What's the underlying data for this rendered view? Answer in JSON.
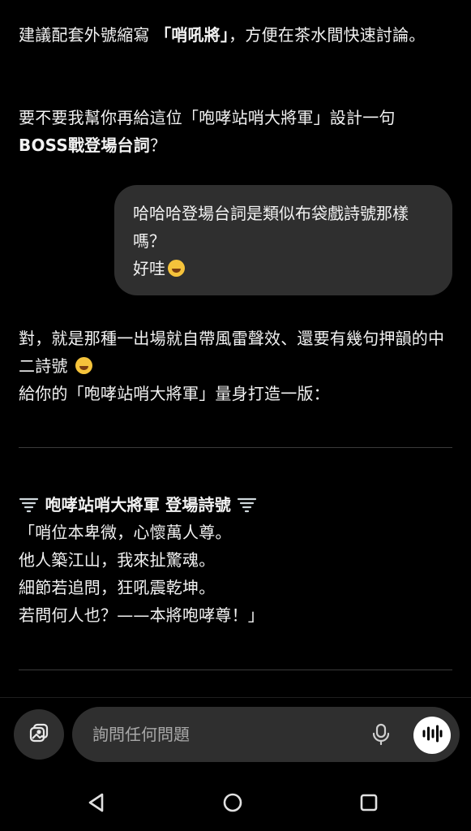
{
  "messages": {
    "p1_a": "建議配套外號縮寫 ",
    "p1_b": "「哨吼將」",
    "p1_c": "，方便在茶水間快速討論。",
    "p2_a": "要不要我幫你再給這位「咆哮站哨大將軍」設計一句",
    "p2_b": "BOSS戰登場台詞",
    "p2_c": "？",
    "user_bubble": "哈哈哈登場台詞是類似布袋戲詩號那樣嗎？\n好哇",
    "p3_a": "對，就是那種一出場就自帶風雷聲效、還要有幾句押韻的中二詩號",
    "p3_b": "給你的「咆哮站哨大將軍」量身打造一版：",
    "poem_title": "咆哮站哨大將軍 登場詩號",
    "poem_lines": [
      "「哨位本卑微，心懷萬人尊。",
      "他人築江山，我來扯驚魂。",
      "細節若追問，狂吼震乾坤。",
      "若問何人也？——本將咆哮尊！」"
    ]
  },
  "composer": {
    "placeholder": "詢問任何問題"
  },
  "icons": {
    "image": "image-icon",
    "mic": "mic-icon",
    "voice": "voice-mode-icon",
    "back": "back-triangle-icon",
    "home": "home-circle-icon",
    "recents": "recents-square-icon",
    "laugh": "rolling-laughing-emoji",
    "giggle": "hand-over-mouth-emoji",
    "tornado": "tornado-emoji"
  },
  "colors": {
    "background": "#000000",
    "bubble": "#2f2f2f",
    "text": "#f2f2f2",
    "placeholder": "#a8a8a8"
  }
}
